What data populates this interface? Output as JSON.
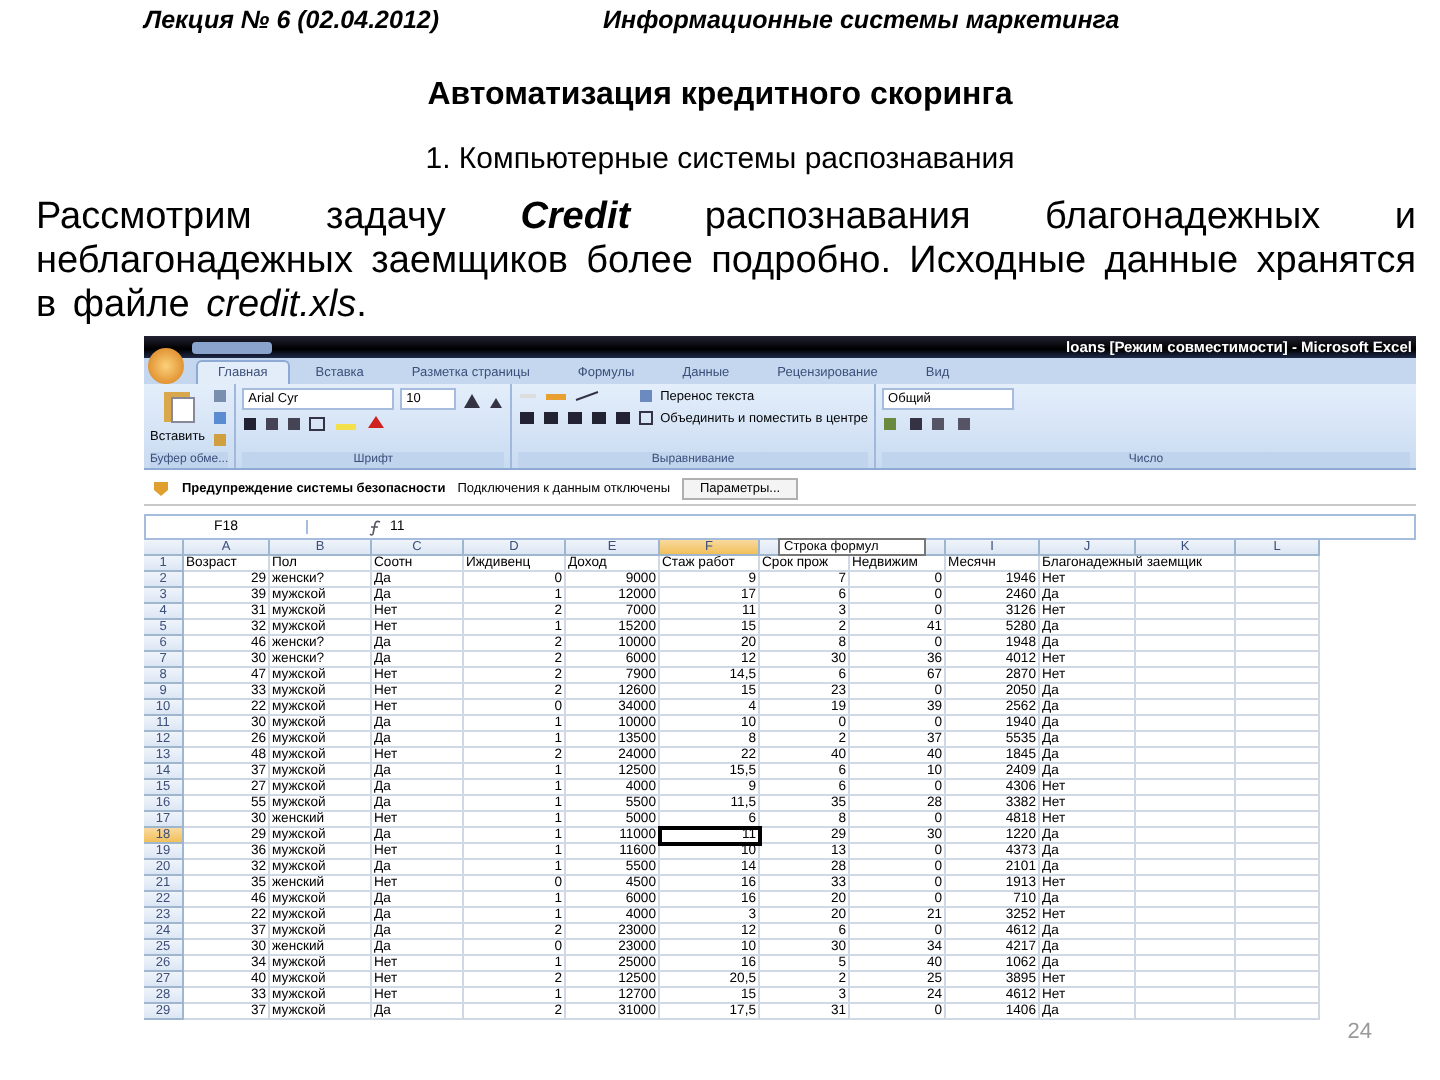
{
  "page_header": {
    "left": "Лекция № 6 (02.04.2012)",
    "right": "Информационные системы маркетинга"
  },
  "title": "Автоматизация кредитного скоринга",
  "subtitle": "1. Компьютерные системы распознавания",
  "paragraph": "Рассмотрим задачу **Credit** распознавания благонадежных и неблагонадежных заемщиков более подробно. Исходные данные хранятся в файле *credit.xls*.",
  "excel": {
    "window_title": "loans [Режим совместимости] - Microsoft Excel",
    "tabs": [
      {
        "label": "Главная",
        "selected": true
      },
      {
        "label": "Вставка",
        "selected": false
      },
      {
        "label": "Разметка страницы",
        "selected": false
      },
      {
        "label": "Формулы",
        "selected": false
      },
      {
        "label": "Данные",
        "selected": false
      },
      {
        "label": "Рецензирование",
        "selected": false
      },
      {
        "label": "Вид",
        "selected": false
      }
    ],
    "ribbon": {
      "paste": "Вставить",
      "font_name": "Arial Cyr",
      "font_size": "10",
      "wrap_text": "Перенос текста",
      "merge": "Объединить и поместить в центре",
      "number_format": "Общий",
      "groups": [
        "Буфер обме...",
        "Шрифт",
        "Выравнивание",
        "Число"
      ]
    },
    "security_bar": {
      "message": "Предупреждение системы безопасности",
      "detail": "Подключения к данным отключены",
      "button": "Параметры..."
    },
    "name_box": "F18",
    "formula": "11",
    "tooltip": "Строка формул",
    "columns": [
      {
        "label": "A",
        "selected": false
      },
      {
        "label": "B",
        "selected": false
      },
      {
        "label": "C",
        "selected": false
      },
      {
        "label": "D",
        "selected": false
      },
      {
        "label": "E",
        "selected": false
      },
      {
        "label": "F",
        "selected": true
      },
      {
        "selected": false
      },
      {
        "selected": false
      },
      {
        "label": "I",
        "selected": false
      },
      {
        "label": "J",
        "selected": false
      },
      {
        "label": "K",
        "selected": false
      },
      {
        "label": "L",
        "selected": false
      }
    ],
    "rows": [
      {
        "number": "1",
        "selected": false,
        "cells": [
          "Возраст",
          "Пол",
          "Соотн",
          "Иждивенц",
          "Доход",
          "Стаж работ",
          "Срок прож",
          "Недвижим",
          "Месячн",
          "Благонадежный заемщик"
        ]
      },
      {
        "number": "2",
        "selected": false,
        "cells": [
          "29",
          "женски?",
          "Да",
          "0",
          "9000",
          "9",
          "7",
          "0",
          "1946",
          "Нет"
        ]
      },
      {
        "number": "3",
        "selected": false,
        "cells": [
          "39",
          "мужской",
          "Да",
          "1",
          "12000",
          "17",
          "6",
          "0",
          "2460",
          "Да"
        ]
      },
      {
        "number": "4",
        "selected": false,
        "cells": [
          "31",
          "мужской",
          "Нет",
          "2",
          "7000",
          "11",
          "3",
          "0",
          "3126",
          "Нет"
        ]
      },
      {
        "number": "5",
        "selected": false,
        "cells": [
          "32",
          "мужской",
          "Нет",
          "1",
          "15200",
          "15",
          "2",
          "41",
          "5280",
          "Да"
        ]
      },
      {
        "number": "6",
        "selected": false,
        "cells": [
          "46",
          "женски?",
          "Да",
          "2",
          "10000",
          "20",
          "8",
          "0",
          "1948",
          "Да"
        ]
      },
      {
        "number": "7",
        "selected": false,
        "cells": [
          "30",
          "женски?",
          "Да",
          "2",
          "6000",
          "12",
          "30",
          "36",
          "4012",
          "Нет"
        ]
      },
      {
        "number": "8",
        "selected": false,
        "cells": [
          "47",
          "мужской",
          "Нет",
          "2",
          "7900",
          "14,5",
          "6",
          "67",
          "2870",
          "Нет"
        ]
      },
      {
        "number": "9",
        "selected": false,
        "cells": [
          "33",
          "мужской",
          "Нет",
          "2",
          "12600",
          "15",
          "23",
          "0",
          "2050",
          "Да"
        ]
      },
      {
        "number": "10",
        "selected": false,
        "cells": [
          "22",
          "мужской",
          "Нет",
          "0",
          "34000",
          "4",
          "19",
          "39",
          "2562",
          "Да"
        ]
      },
      {
        "number": "11",
        "selected": false,
        "cells": [
          "30",
          "мужской",
          "Да",
          "1",
          "10000",
          "10",
          "0",
          "0",
          "1940",
          "Да"
        ]
      },
      {
        "number": "12",
        "selected": false,
        "cells": [
          "26",
          "мужской",
          "Да",
          "1",
          "13500",
          "8",
          "2",
          "37",
          "5535",
          "Да"
        ]
      },
      {
        "number": "13",
        "selected": false,
        "cells": [
          "48",
          "мужской",
          "Нет",
          "2",
          "24000",
          "22",
          "40",
          "40",
          "1845",
          "Да"
        ]
      },
      {
        "number": "14",
        "selected": false,
        "cells": [
          "37",
          "мужской",
          "Да",
          "1",
          "12500",
          "15,5",
          "6",
          "10",
          "2409",
          "Да"
        ]
      },
      {
        "number": "15",
        "selected": false,
        "cells": [
          "27",
          "мужской",
          "Да",
          "1",
          "4000",
          "9",
          "6",
          "0",
          "4306",
          "Нет"
        ]
      },
      {
        "number": "16",
        "selected": false,
        "cells": [
          "55",
          "мужской",
          "Да",
          "1",
          "5500",
          "11,5",
          "35",
          "28",
          "3382",
          "Нет"
        ]
      },
      {
        "number": "17",
        "selected": false,
        "cells": [
          "30",
          "женский",
          "Нет",
          "1",
          "5000",
          "6",
          "8",
          "0",
          "4818",
          "Нет"
        ]
      },
      {
        "number": "18",
        "selected": true,
        "cells": [
          "29",
          "мужской",
          "Да",
          "1",
          "11000",
          "11",
          "29",
          "30",
          "1220",
          "Да"
        ]
      },
      {
        "number": "19",
        "selected": false,
        "cells": [
          "36",
          "мужской",
          "Нет",
          "1",
          "11600",
          "10",
          "13",
          "0",
          "4373",
          "Да"
        ]
      },
      {
        "number": "20",
        "selected": false,
        "cells": [
          "32",
          "мужской",
          "Да",
          "1",
          "5500",
          "14",
          "28",
          "0",
          "2101",
          "Да"
        ]
      },
      {
        "number": "21",
        "selected": false,
        "cells": [
          "35",
          "женский",
          "Нет",
          "0",
          "4500",
          "16",
          "33",
          "0",
          "1913",
          "Нет"
        ]
      },
      {
        "number": "22",
        "selected": false,
        "cells": [
          "46",
          "мужской",
          "Да",
          "1",
          "6000",
          "16",
          "20",
          "0",
          "710",
          "Да"
        ]
      },
      {
        "number": "23",
        "selected": false,
        "cells": [
          "22",
          "мужской",
          "Да",
          "1",
          "4000",
          "3",
          "20",
          "21",
          "3252",
          "Нет"
        ]
      },
      {
        "number": "24",
        "selected": false,
        "cells": [
          "37",
          "мужской",
          "Да",
          "2",
          "23000",
          "12",
          "6",
          "0",
          "4612",
          "Да"
        ]
      },
      {
        "number": "25",
        "selected": false,
        "cells": [
          "30",
          "женский",
          "Да",
          "0",
          "23000",
          "10",
          "30",
          "34",
          "4217",
          "Да"
        ]
      },
      {
        "number": "26",
        "selected": false,
        "cells": [
          "34",
          "мужской",
          "Нет",
          "1",
          "25000",
          "16",
          "5",
          "40",
          "1062",
          "Да"
        ]
      },
      {
        "number": "27",
        "selected": false,
        "cells": [
          "40",
          "мужской",
          "Нет",
          "2",
          "12500",
          "20,5",
          "2",
          "25",
          "3895",
          "Нет"
        ]
      },
      {
        "number": "28",
        "selected": false,
        "cells": [
          "33",
          "мужской",
          "Нет",
          "1",
          "12700",
          "15",
          "3",
          "24",
          "4612",
          "Нет"
        ]
      },
      {
        "number": "29",
        "selected": false,
        "cells": [
          "37",
          "мужской",
          "Да",
          "2",
          "31000",
          "17,5",
          "31",
          "0",
          "1406",
          "Да"
        ]
      }
    ]
  },
  "page_number": "24"
}
